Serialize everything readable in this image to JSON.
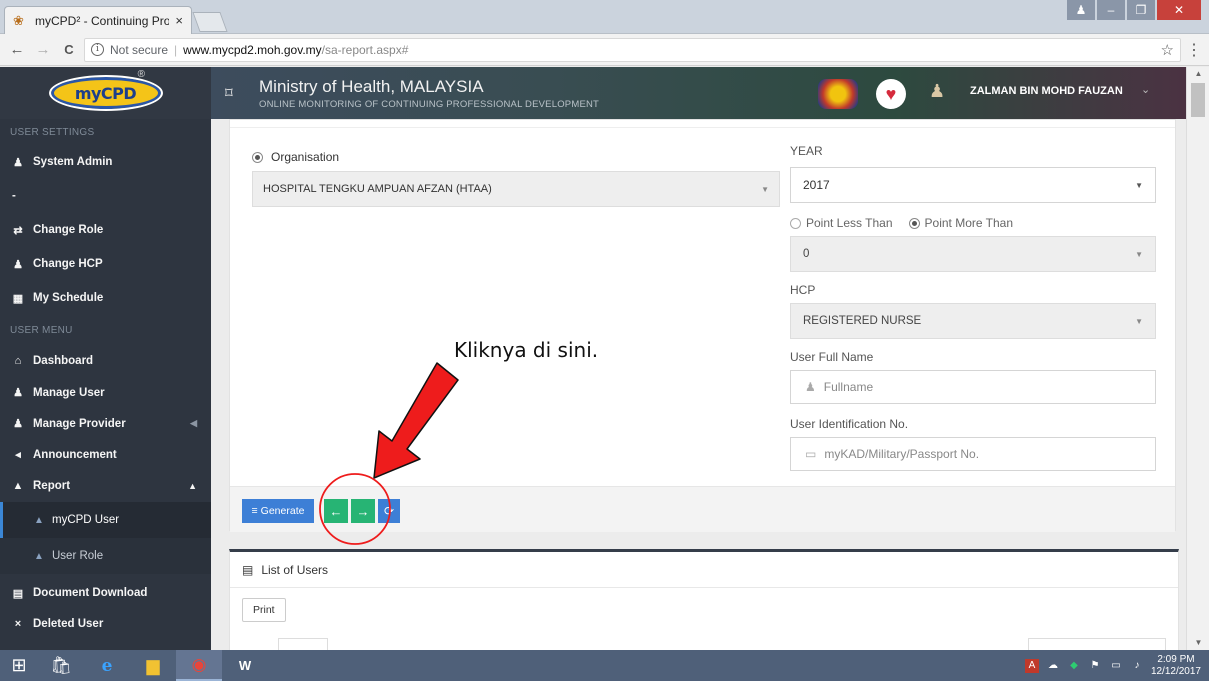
{
  "browser": {
    "tab_title": "myCPD² - Continuing Pro",
    "tab_close": "×",
    "secure_text": "Not secure",
    "url_host": "www.mycpd2.moh.gov.my",
    "url_path": "/sa-report.aspx#",
    "star": "☆",
    "menu": "⋮",
    "back": "←",
    "forward": "→",
    "reload": "C"
  },
  "header": {
    "logo_text": "myCPD",
    "logo_mark": "®",
    "title": "Ministry of Health, MALAYSIA",
    "subtitle": "ONLINE MONITORING OF CONTINUING PROFESSIONAL DEVELOPMENT",
    "user_name": "ZALMAN BIN MOHD FAUZAN",
    "user_caret": "⌄"
  },
  "sidebar": {
    "settings_heading": "USER SETTINGS",
    "settings_items": [
      {
        "label": "System Admin",
        "icon": "♟"
      },
      {
        "label": "-",
        "icon": ""
      },
      {
        "label": "Change Role",
        "icon": "⇄"
      },
      {
        "label": "Change HCP",
        "icon": "♟"
      },
      {
        "label": "My Schedule",
        "icon": "▦"
      }
    ],
    "menu_heading": "USER MENU",
    "menu_items": [
      {
        "label": "Dashboard",
        "icon": "⌂"
      },
      {
        "label": "Manage User",
        "icon": "♟"
      },
      {
        "label": "Manage Provider",
        "icon": "♟"
      },
      {
        "label": "Announcement",
        "icon": "◂"
      },
      {
        "label": "Report",
        "icon": "▲"
      }
    ],
    "report_subitems": [
      {
        "label": "myCPD User",
        "icon": "▲"
      },
      {
        "label": "User Role",
        "icon": "▲"
      }
    ],
    "bottom_items": [
      {
        "label": "Document Download",
        "icon": "▤"
      },
      {
        "label": "Deleted User",
        "icon": "×"
      }
    ]
  },
  "form": {
    "org_label": "Organisation",
    "org_value": "HOSPITAL TENGKU AMPUAN AFZAN (HTAA)",
    "year_label": "YEAR",
    "year_value": "2017",
    "point_less": "Point Less Than",
    "point_more": "Point More Than",
    "point_value": "0",
    "hcp_label": "HCP",
    "hcp_value": "REGISTERED NURSE",
    "fullname_label": "User Full Name",
    "fullname_placeholder": "Fullname",
    "ic_label": "User Identification No.",
    "ic_placeholder": "myKAD/Military/Passport No."
  },
  "buttons": {
    "generate": "Generate",
    "prev": "←",
    "next": "→",
    "refresh": "⟳"
  },
  "list": {
    "title": "List of Users",
    "print": "Print"
  },
  "annotation": {
    "text": "Kliknya di sini.",
    "color": "#ee1c1c"
  },
  "taskbar": {
    "time": "2:09 PM",
    "date": "12/12/2017"
  }
}
